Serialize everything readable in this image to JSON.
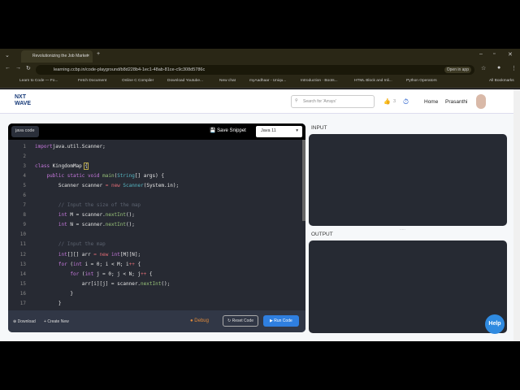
{
  "browser": {
    "tab_title": "Revolutionizing the Job Market",
    "url": "learning.ccbp.in/code-playground/b8d228b4-1ec1-48ab-81ce-c9c308d5786c",
    "open_in_app": "Open in app",
    "bookmarks": [
      "Learn to Code — Fo...",
      "Fetch Document",
      "Online C Compiler",
      "Download Youtube...",
      "New chat",
      "myAadhaar - Uniqu...",
      "Introduction · Boots...",
      "HTML Block and Inli...",
      "Python Operators"
    ],
    "all_bookmarks": "All Bookmarks"
  },
  "header": {
    "logo": "NXT WAVE",
    "search_placeholder": "Search for 'Arrays'",
    "streak": "3",
    "home": "Home",
    "user": "Prasanthi"
  },
  "editor": {
    "tab": "java code",
    "save": "Save Snippet",
    "language": "Java 11",
    "lines": [
      [
        [
          "kw",
          "import"
        ],
        [
          "",
          "java.util.Scanner;"
        ]
      ],
      [],
      [
        [
          "kw",
          "class"
        ],
        [
          "",
          " KingdomMap "
        ],
        [
          "br",
          "{"
        ]
      ],
      [
        [
          "",
          "    "
        ],
        [
          "kw",
          "public static void"
        ],
        [
          "",
          " "
        ],
        [
          "fn",
          "main"
        ],
        [
          "",
          "("
        ],
        [
          "ty",
          "String"
        ],
        [
          "",
          "[] args) {"
        ]
      ],
      [
        [
          "",
          "        Scanner scanner "
        ],
        [
          "op",
          "="
        ],
        [
          "",
          " "
        ],
        [
          "op",
          "new"
        ],
        [
          "",
          " "
        ],
        [
          "ty",
          "Scanner"
        ],
        [
          "",
          "(System.in);"
        ]
      ],
      [],
      [
        [
          "cm",
          "        // Input the size of the map"
        ]
      ],
      [
        [
          "",
          "        "
        ],
        [
          "kw",
          "int"
        ],
        [
          "",
          " M = scanner."
        ],
        [
          "fn",
          "nextInt"
        ],
        [
          "",
          "();"
        ]
      ],
      [
        [
          "",
          "        "
        ],
        [
          "kw",
          "int"
        ],
        [
          "",
          " N = scanner."
        ],
        [
          "fn",
          "nextInt"
        ],
        [
          "",
          "();"
        ]
      ],
      [],
      [
        [
          "cm",
          "        // Input the map"
        ]
      ],
      [
        [
          "",
          "        "
        ],
        [
          "kw",
          "int"
        ],
        [
          "",
          "[][] arr "
        ],
        [
          "op",
          "="
        ],
        [
          "",
          " "
        ],
        [
          "op",
          "new"
        ],
        [
          "",
          " "
        ],
        [
          "kw",
          "int"
        ],
        [
          "",
          "[M][N];"
        ]
      ],
      [
        [
          "",
          "        "
        ],
        [
          "kw",
          "for"
        ],
        [
          "",
          " ("
        ],
        [
          "kw",
          "int"
        ],
        [
          "",
          " i = 0; i < M; i"
        ],
        [
          "op",
          "++"
        ],
        [
          "",
          " {"
        ]
      ],
      [
        [
          "",
          "            "
        ],
        [
          "kw",
          "for"
        ],
        [
          "",
          " ("
        ],
        [
          "kw",
          "int"
        ],
        [
          "",
          " j = 0; j < N; j"
        ],
        [
          "op",
          "++"
        ],
        [
          "",
          " {"
        ]
      ],
      [
        [
          "",
          "                arr[i][j] = scanner."
        ],
        [
          "fn",
          "nextInt"
        ],
        [
          "",
          "();"
        ]
      ],
      [
        [
          "",
          "            }"
        ]
      ],
      [
        [
          "",
          "        }"
        ]
      ]
    ],
    "download": "Download",
    "create_new": "Create New",
    "debug": "Debug",
    "reset": "Reset Code",
    "run": "Run Code"
  },
  "io": {
    "input_label": "INPUT",
    "output_label": "OUTPUT"
  },
  "help": "Help"
}
